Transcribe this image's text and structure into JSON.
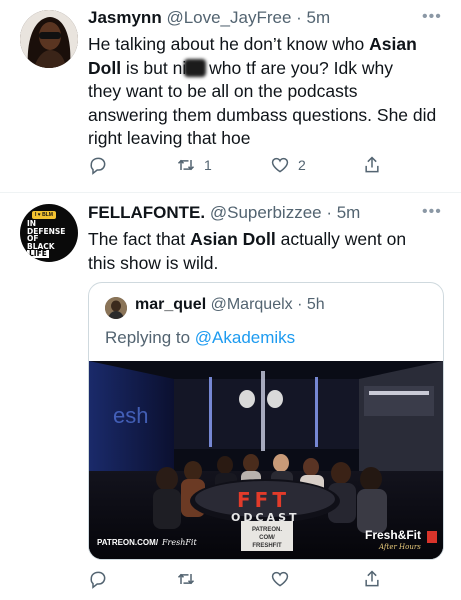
{
  "tweet1": {
    "name": "Jasmynn",
    "handle": "@Love_JayFree",
    "time": "5m",
    "text_lines": [
      [
        "He talking about he don’t know who ",
        "Asian"
      ],
      [
        "Doll",
        " is but ni",
        "",
        " who tf are you? Idk why"
      ],
      [
        "they want to be all on the podcasts"
      ],
      [
        "answering them dumbass questions. She did"
      ],
      [
        "right leaving that hoe"
      ]
    ],
    "retweets": "1",
    "likes": "2"
  },
  "tweet2": {
    "name": "FELLAFONTE.",
    "handle": "@Superbizzee",
    "time": "5m",
    "avatar_text": [
      "IN",
      "DEFENSE",
      "OF",
      "BLACK",
      "LIFE"
    ],
    "avatar_badge": "I ♥ BLM",
    "text_line1_pre": "The fact that ",
    "text_line1_bold": "Asian Doll",
    "text_line1_post": " actually went on",
    "text_line2": "this show is wild."
  },
  "quote": {
    "name": "mar_quel",
    "handle": "@Marquelx",
    "time": "5h",
    "reply_prefix": "Replying to ",
    "reply_to": "@Akademiks",
    "video": {
      "watermark_left": "PATREON.COM/",
      "watermark_left_script": "FreshFit",
      "center_sign": [
        "PATREON.",
        "COM/",
        "FRESHFIT"
      ],
      "logo_main": "Fresh&Fit",
      "logo_sub": "After Hours",
      "table_text": "FFT",
      "table_sub": "ODCAST",
      "wall_text": "esh"
    }
  },
  "colors": {
    "text": "#0f1419",
    "muted": "#536471",
    "link": "#1d9bf0",
    "border": "#cfd9de"
  }
}
